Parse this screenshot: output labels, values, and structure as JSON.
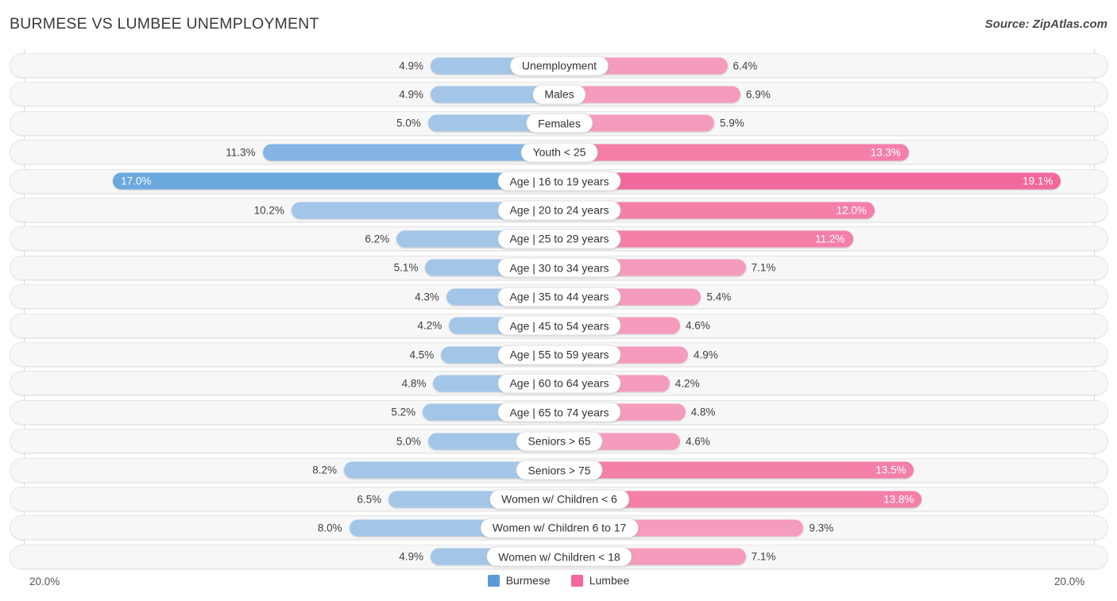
{
  "header": {
    "title": "BURMESE VS LUMBEE UNEMPLOYMENT",
    "source": "Source: ZipAtlas.com"
  },
  "axis": {
    "left_label": "20.0%",
    "right_label": "20.0%"
  },
  "legend": {
    "items": [
      {
        "label": "Burmese",
        "color": "#5b9bd5"
      },
      {
        "label": "Lumbee",
        "color": "#f2689c"
      }
    ]
  },
  "chart_data": {
    "type": "bar",
    "title": "BURMESE VS LUMBEE UNEMPLOYMENT",
    "subtitle": "Source: ZipAtlas.com",
    "orientation": "horizontal-diverging",
    "xlabel": "",
    "ylabel": "",
    "xlim": [
      0,
      20
    ],
    "axis_max": 20.0,
    "axis_unit": "%",
    "grid": false,
    "legend_position": "bottom-center",
    "categories": [
      "Unemployment",
      "Males",
      "Females",
      "Youth < 25",
      "Age | 16 to 19 years",
      "Age | 20 to 24 years",
      "Age | 25 to 29 years",
      "Age | 30 to 34 years",
      "Age | 35 to 44 years",
      "Age | 45 to 54 years",
      "Age | 55 to 59 years",
      "Age | 60 to 64 years",
      "Age | 65 to 74 years",
      "Seniors > 65",
      "Seniors > 75",
      "Women w/ Children < 6",
      "Women w/ Children 6 to 17",
      "Women w/ Children < 18"
    ],
    "series": [
      {
        "name": "Burmese",
        "color": "#a3c6e8",
        "values": [
          4.9,
          4.9,
          5.0,
          11.3,
          17.0,
          10.2,
          6.2,
          5.1,
          4.3,
          4.2,
          4.5,
          4.8,
          5.2,
          5.0,
          8.2,
          6.5,
          8.0,
          4.9
        ],
        "labels": [
          "4.9%",
          "4.9%",
          "5.0%",
          "11.3%",
          "17.0%",
          "10.2%",
          "6.2%",
          "5.1%",
          "4.3%",
          "4.2%",
          "4.5%",
          "4.8%",
          "5.2%",
          "5.0%",
          "8.2%",
          "6.5%",
          "8.0%",
          "4.9%"
        ]
      },
      {
        "name": "Lumbee",
        "color": "#f59cbe",
        "values": [
          6.4,
          6.9,
          5.9,
          13.3,
          19.1,
          12.0,
          11.2,
          7.1,
          5.4,
          4.6,
          4.9,
          4.2,
          4.8,
          4.6,
          13.5,
          13.8,
          9.3,
          7.1
        ],
        "labels": [
          "6.4%",
          "6.9%",
          "5.9%",
          "13.3%",
          "19.1%",
          "12.0%",
          "11.2%",
          "7.1%",
          "5.4%",
          "4.6%",
          "4.9%",
          "4.2%",
          "4.8%",
          "4.6%",
          "13.5%",
          "13.8%",
          "9.3%",
          "7.1%"
        ]
      }
    ]
  }
}
